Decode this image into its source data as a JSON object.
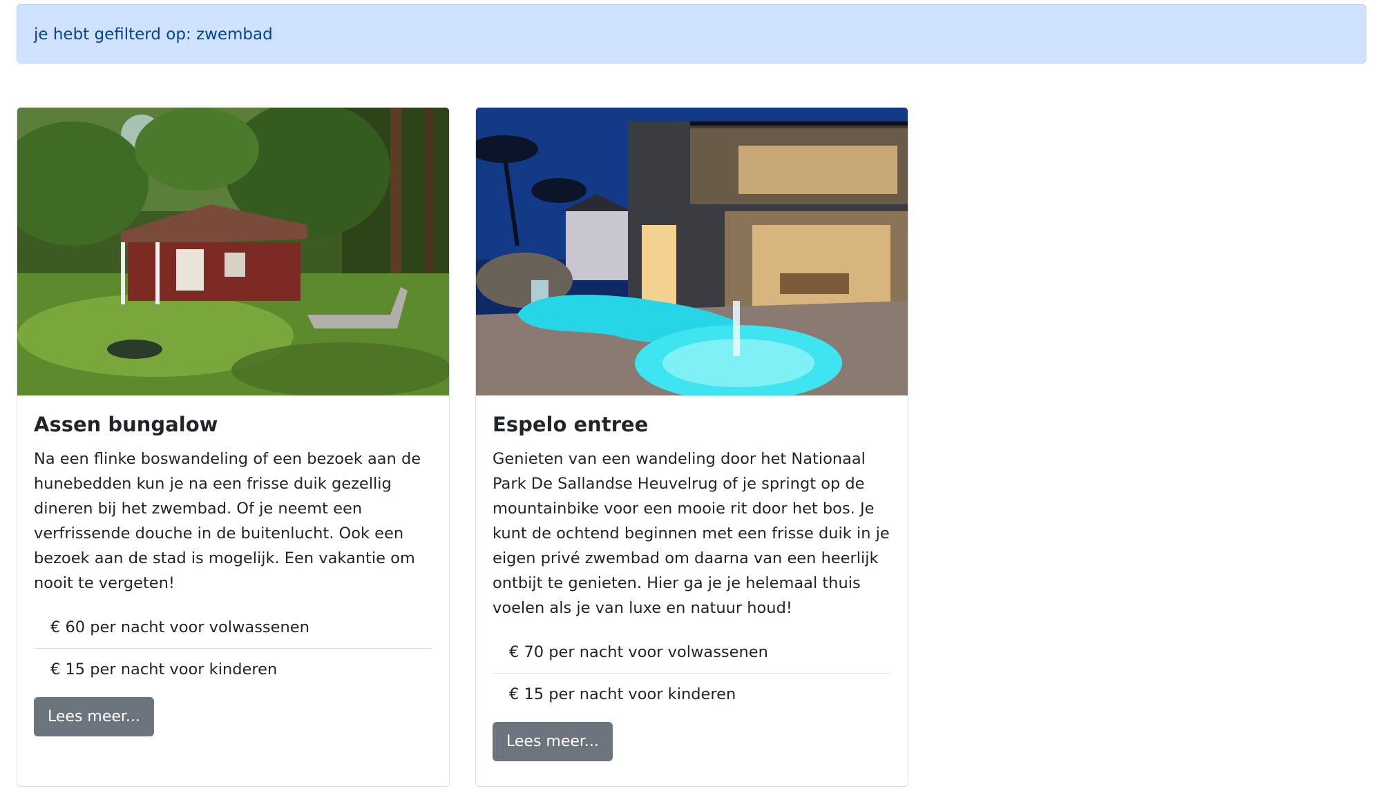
{
  "alert": {
    "text": "je hebt gefilterd op: zwembad"
  },
  "cards": [
    {
      "title": "Assen bungalow",
      "description": "Na een flinke boswandeling of een bezoek aan de hunebedden kun je na een frisse duik gezellig dineren bij het zwembad. Of je neemt een verfrissende douche in de buitenlucht. Ook een bezoek aan de stad is mogelijk. Een vakantie om nooit te vergeten!",
      "prices": [
        "€ 60 per nacht voor volwassenen",
        "€ 15 per nacht voor kinderen"
      ],
      "button_label": "Lees meer..."
    },
    {
      "title": "Espelo entree",
      "description": "Genieten van een wandeling door het Nationaal Park De Sallandse Heuvelrug of je springt op de mountainbike voor een mooie rit door het bos. Je kunt de ochtend beginnen met een frisse duik in je eigen privé zwembad om daarna van een heerlijk ontbijt te genieten. Hier ga je je helemaal thuis voelen als je van luxe en natuur houd!",
      "prices": [
        "€ 70 per nacht voor volwassenen",
        "€ 15 per nacht voor kinderen"
      ],
      "button_label": "Lees meer..."
    }
  ],
  "colors": {
    "alert_bg": "#cfe2ff",
    "alert_text": "#084298",
    "button_bg": "#6c757d"
  }
}
